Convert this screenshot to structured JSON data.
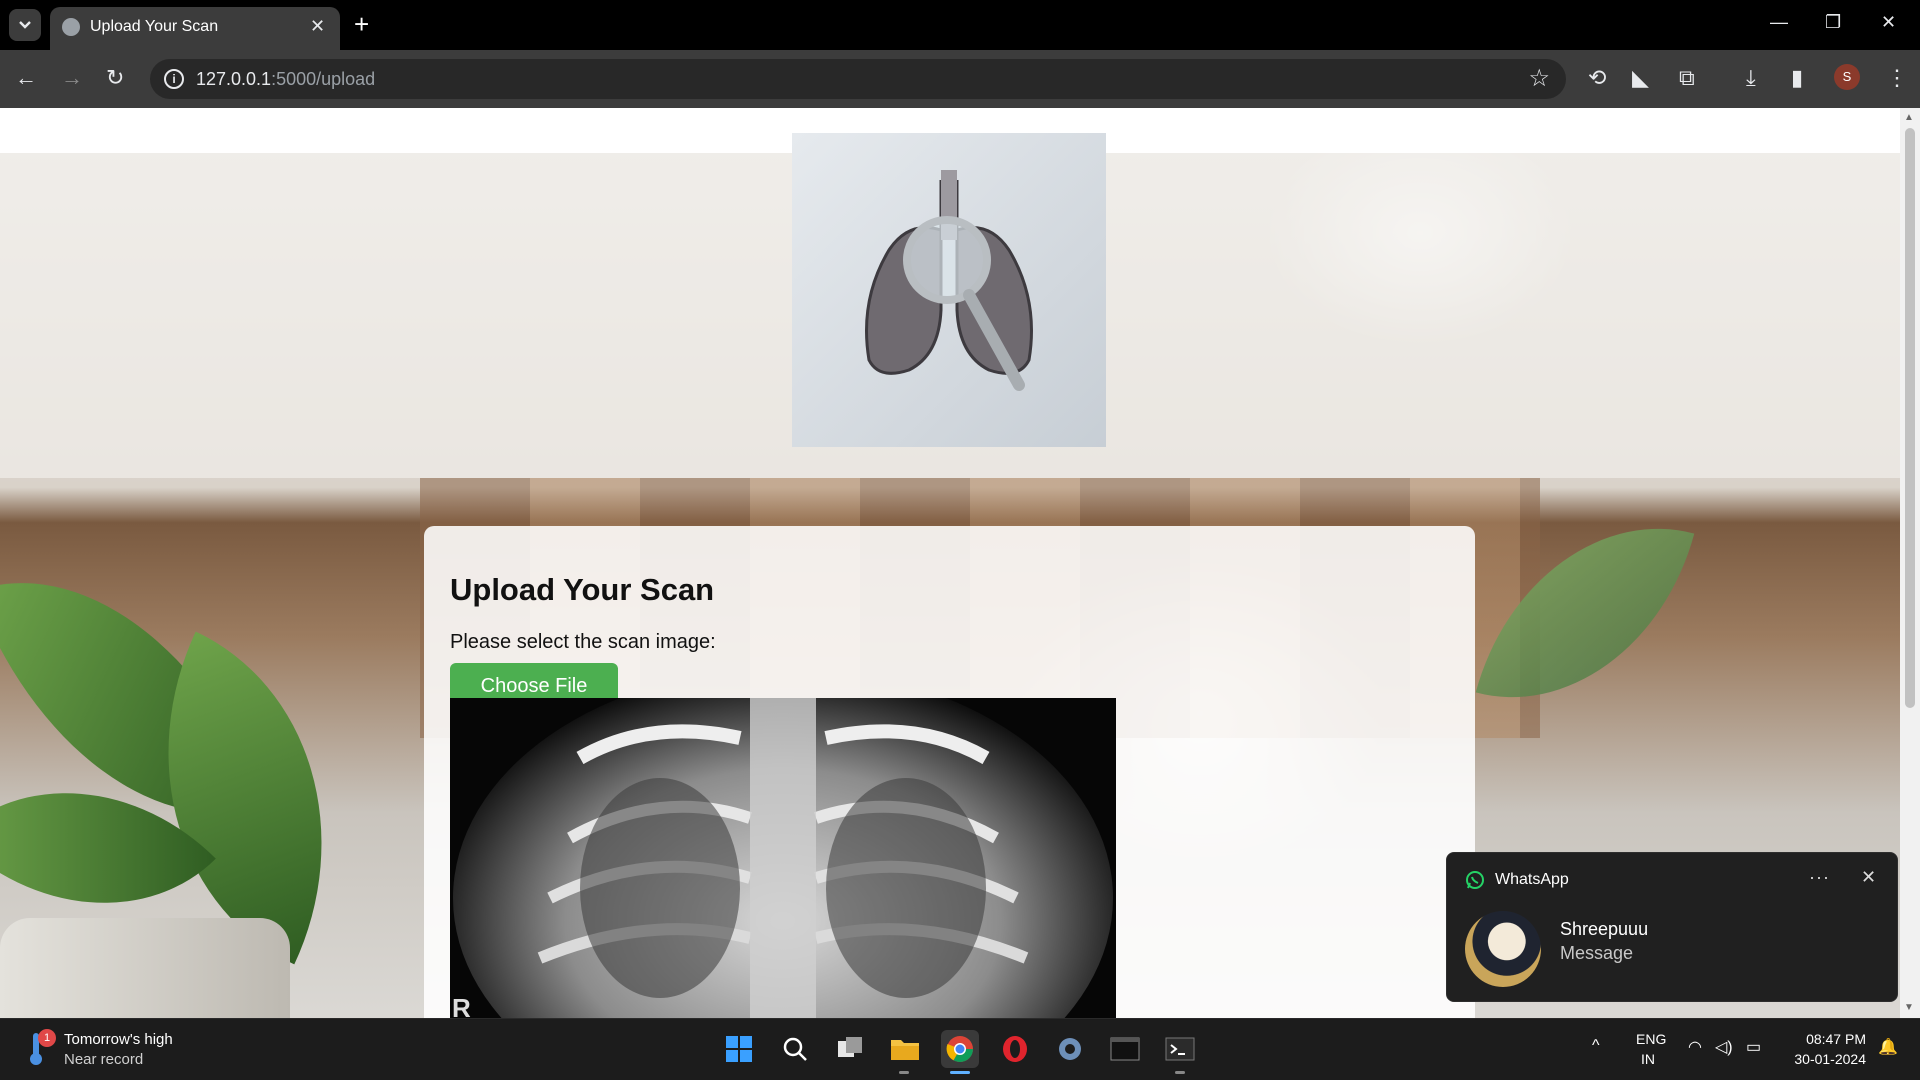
{
  "browser": {
    "tab_title": "Upload Your Scan",
    "url_host": "127.0.0.1",
    "url_rest": ":5000/upload",
    "profile_initial": "S"
  },
  "page": {
    "card_title": "Upload Your Scan",
    "select_label": "Please select the scan image:",
    "choose_file_label": "Choose File",
    "xray_marker": "R"
  },
  "notification": {
    "app": "WhatsApp",
    "sender": "Shreepuuu",
    "message": "Message",
    "more_label": "···"
  },
  "taskbar": {
    "weather_line1": "Tomorrow's high",
    "weather_line2": "Near record",
    "weather_badge": "1",
    "lang_line1": "ENG",
    "lang_line2": "IN",
    "time": "08:47 PM",
    "date": "30-01-2024"
  },
  "colors": {
    "accent_button": "#4caf50",
    "whatsapp": "#25d366",
    "chrome_toolbar": "#3c3c3c"
  }
}
